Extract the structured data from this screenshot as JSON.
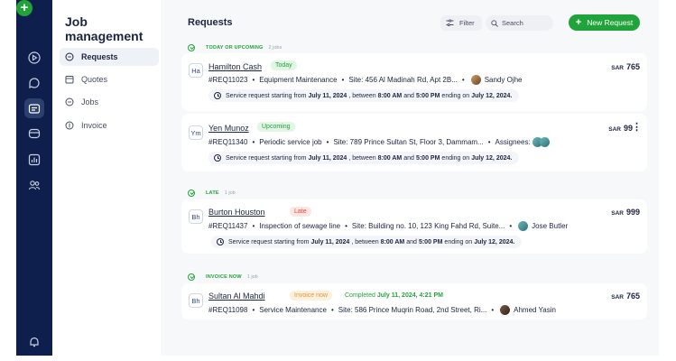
{
  "rail": {
    "items": [
      {
        "name": "add-icon",
        "glyph": "+"
      },
      {
        "name": "play-icon"
      },
      {
        "name": "chat-icon"
      },
      {
        "name": "briefcase-icon"
      },
      {
        "name": "inbox-icon"
      },
      {
        "name": "chart-icon"
      },
      {
        "name": "users-icon"
      },
      {
        "name": "bell-icon"
      }
    ]
  },
  "sidepanel": {
    "title": "Job management",
    "items": [
      {
        "label": "Requests",
        "icon": "chat-bubble-icon",
        "active": true
      },
      {
        "label": "Quotes",
        "icon": "calendar-icon",
        "active": false
      },
      {
        "label": "Jobs",
        "icon": "link-icon",
        "active": false
      },
      {
        "label": "Invoice",
        "icon": "dollar-icon",
        "active": false
      }
    ]
  },
  "header": {
    "title": "Requests",
    "filter_label": "Filter",
    "search_placeholder": "Search",
    "new_request_label": "New Request",
    "new_request_glyph": "+"
  },
  "sections": [
    {
      "label": "TODAY OR UPCOMING",
      "count": "2 jobs"
    },
    {
      "label": "LATE",
      "count": "1 job"
    },
    {
      "label": "INVOICE NOW",
      "count": "1 job"
    }
  ],
  "separator": "•",
  "currency": "SAR",
  "assignees_label": "Assignees:",
  "schedule_parts": {
    "prefix": "Service request starting from",
    "between": ", between",
    "and": "and",
    "ending": "ending on"
  },
  "requests": [
    {
      "initials": "Ha",
      "name": "Hamilton Cash",
      "badge": "Today",
      "id": "#REQ11023",
      "service": "Equipment Maintenance",
      "site": "Site: 456 Al Madinah Rd, Apt 2B...",
      "assignee": "Sandy Ojhe",
      "start_date": "July 11, 2024",
      "start_time": "8:00 AM",
      "end_time": "5:00 PM",
      "end_date": "July 12, 2024.",
      "price": "765"
    },
    {
      "initials": "Ym",
      "name": "Yen Munoz",
      "badge": "Upcoming",
      "id": "#REQ11340",
      "service": "Periodic service job",
      "site": "Site: 789 Prince Sultan St, Floor 3, Dammam...",
      "start_date": "July 11, 2024",
      "start_time": "8:00 AM",
      "end_time": "5:00 PM",
      "end_date": "July 12, 2024.",
      "price": "99",
      "kebab": "⋮"
    },
    {
      "initials": "Bh",
      "name": "Burton Houston",
      "badge": "Late",
      "id": "#REQ11437",
      "service": "Inspection of sewage line",
      "site": "Site: Building no. 10, 123 King Fahd Rd, Suite...",
      "assignee": "Jose Butler",
      "start_date": "July 11, 2024",
      "start_time": "8:00 AM",
      "end_time": "5:00 PM",
      "end_date": "July 12, 2024.",
      "price": "999"
    },
    {
      "initials": "Bh",
      "name": "Sultan Al Mahdi",
      "badge": "Invoice now",
      "completed_label": "Completed",
      "completed_value": "July 11, 2024, 4:21 PM",
      "id": "#REQ11098",
      "service": "Service Maintenance",
      "site": "Site: 586 Prince Muqrin Road, 2nd Street, Ri...",
      "assignee": "Ahmed Yasin",
      "price": "765"
    }
  ],
  "colors": {
    "rail": "#0e1f4d",
    "accent_green": "#1fa33a",
    "late_red": "#e04e33",
    "invoice_orange": "#e59436"
  }
}
